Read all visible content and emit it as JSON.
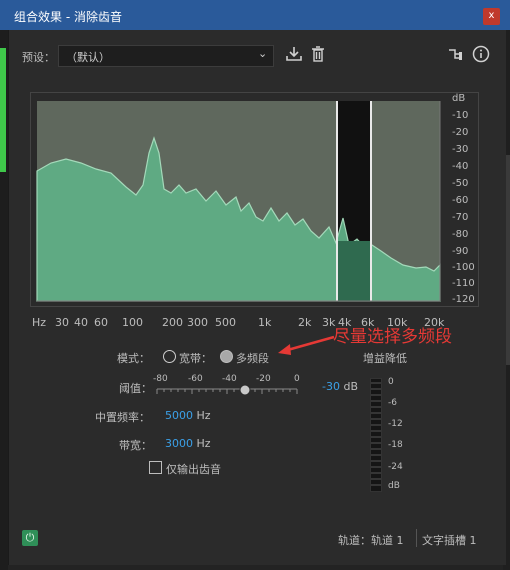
{
  "window": {
    "title": "组合效果 - 消除齿音",
    "close_label": "x"
  },
  "preset": {
    "label": "预设：",
    "value": "（默认）"
  },
  "icons": {
    "download": "download-icon",
    "delete": "trash-icon",
    "routing": "routing-icon",
    "info": "info-icon",
    "power": "power-icon"
  },
  "graph": {
    "x_labels": [
      "Hz",
      "30",
      "40",
      "60",
      "100",
      "200",
      "300",
      "500",
      "1k",
      "2k",
      "3k",
      "4k",
      "6k",
      "10k",
      "20k"
    ],
    "db_labels": [
      "dB",
      "-10",
      "-20",
      "-30",
      "-40",
      "-50",
      "-60",
      "-70",
      "-80",
      "-90",
      "-100",
      "-110",
      "-120"
    ]
  },
  "annotation": "尽量选择多频段",
  "mode": {
    "label": "模式：",
    "option_wide": "宽带：",
    "option_multi": "多频段",
    "selected": "多频段"
  },
  "gain_reduction": {
    "label": "增益降低",
    "scale": [
      "0",
      "-6",
      "-12",
      "-18",
      "-24",
      "dB"
    ]
  },
  "threshold": {
    "label": "阈值：",
    "scale": [
      "-80",
      "-60",
      "-40",
      "-20",
      "0"
    ],
    "value": "-30",
    "unit": "dB",
    "level": -30
  },
  "center_freq": {
    "label": "中置频率：",
    "value": "5000",
    "unit": "Hz"
  },
  "bandwidth": {
    "label": "带宽：",
    "value": "3000",
    "unit": "Hz"
  },
  "output_sibilance_only": {
    "label": "仅输出齿音",
    "checked": false
  },
  "footer": {
    "track": "轨道：轨道 1",
    "slot": "文字插槽 1"
  },
  "colors": {
    "spectrum": "#5fae86",
    "accent": "#3ba0e8",
    "title_bar": "#2a5a9a",
    "annotation": "#e53935"
  }
}
